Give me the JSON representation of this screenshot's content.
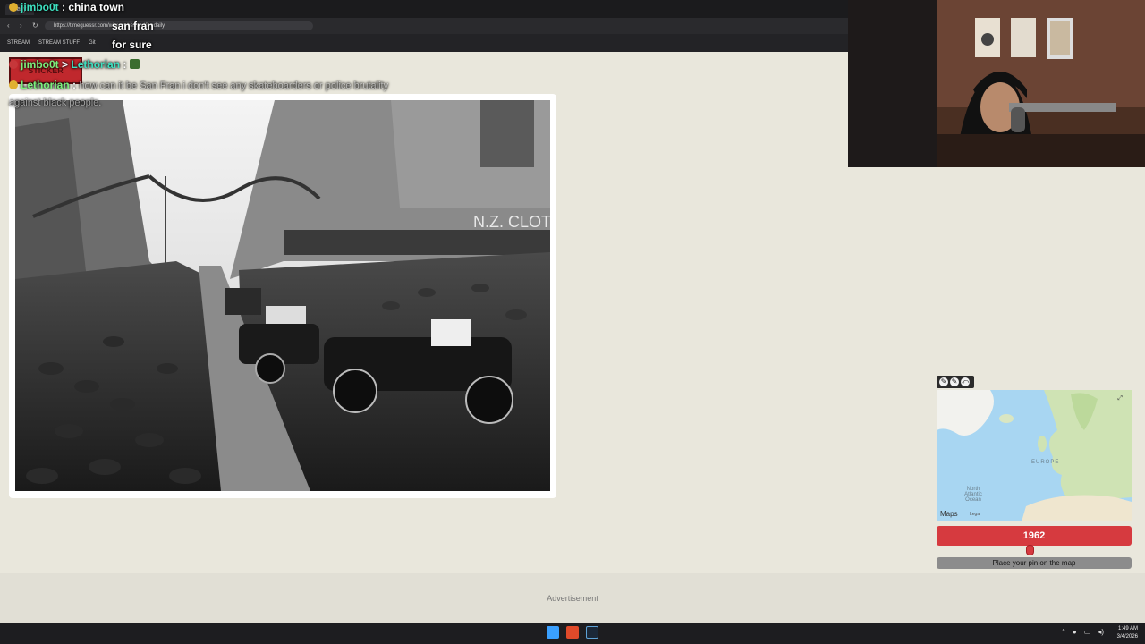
{
  "browser": {
    "tab_title": "Daily",
    "url": "https://timeguessr.com/wherewhenandfivedaily",
    "bookmarks": [
      "STREAM",
      "STREAM STUFF",
      "Git"
    ]
  },
  "chat": [
    {
      "user": "jimbo0t",
      "message": "china town"
    },
    {
      "user": "",
      "message": "san fran"
    },
    {
      "user": "",
      "message": "for sure"
    },
    {
      "user": "jimbo0t",
      "mention": "Lethorian",
      "message": ":"
    },
    {
      "user": "Lethorian",
      "message": "how can it be San Fran i don't see any skateboarders or police brutality against black people."
    }
  ],
  "sticker_text": "STICKER",
  "photo": {
    "sign_text": "N.Z. CLOT"
  },
  "map": {
    "label_europe": "EUROPE",
    "label_ocean": "North Atlantic Ocean",
    "brand": "Maps",
    "legal": "Legal",
    "tools": [
      "✎",
      "✎",
      "⤺"
    ]
  },
  "game": {
    "year": "1962",
    "slider_value": 0.48,
    "pin_button": "Place your pin on the map"
  },
  "ad": {
    "label": "Advertisement"
  },
  "taskbar": {
    "time": "1:49 AM",
    "date": "3/4/2026"
  }
}
